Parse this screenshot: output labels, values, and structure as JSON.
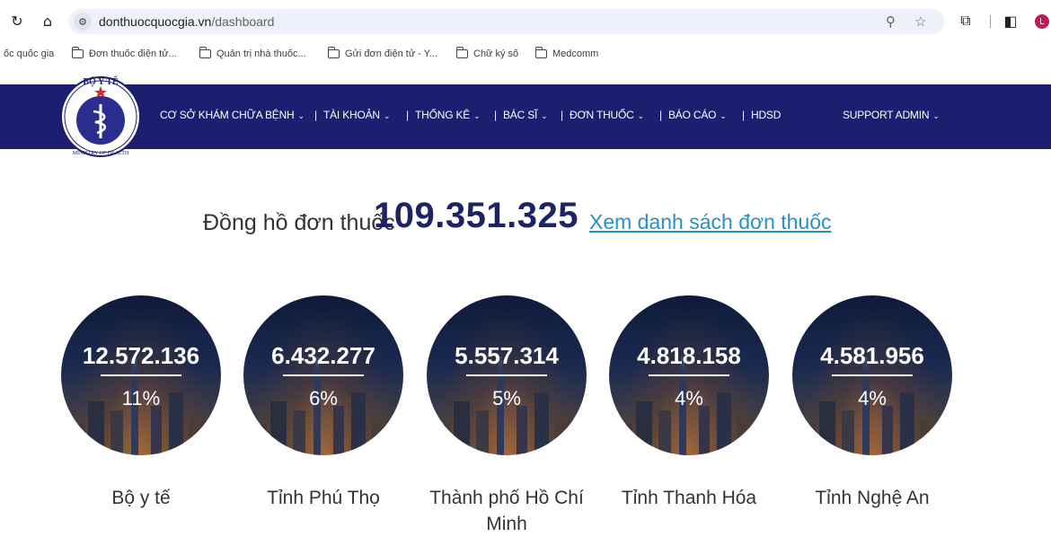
{
  "browser": {
    "url_domain": "donthuocquocgia.vn",
    "url_path": "/dashboard",
    "profile_initial": "L",
    "bookmarks": [
      "ốc quốc gia",
      "Đơn thuốc điện tử...",
      "Quản trị nhà thuốc...",
      "Gửi đơn điện tử - Y...",
      "Chữ ký số",
      "Medcomm"
    ]
  },
  "logo": {
    "top_text": "BỘ Y TẾ",
    "bottom_text": "MINISTRY OF HEALTH"
  },
  "nav": {
    "items": [
      "CƠ SỞ KHÁM CHỮA BỆNH",
      "TÀI KHOẢN",
      "THỐNG KÊ",
      "BÁC SĨ",
      "ĐƠN THUỐC",
      "BÁO CÁO",
      "HDSD"
    ],
    "user_menu": "SUPPORT ADMIN"
  },
  "counter": {
    "label": "Đồng hồ đơn thuốc",
    "value": "109.351.325",
    "link": "Xem danh sách đơn thuốc"
  },
  "stats": [
    {
      "count": "12.572.136",
      "percent": "11%",
      "name": "Bộ y tế"
    },
    {
      "count": "6.432.277",
      "percent": "6%",
      "name": "Tỉnh Phú Thọ"
    },
    {
      "count": "5.557.314",
      "percent": "5%",
      "name": "Thành phố Hồ Chí Minh"
    },
    {
      "count": "4.818.158",
      "percent": "4%",
      "name": "Tỉnh Thanh Hóa"
    },
    {
      "count": "4.581.956",
      "percent": "4%",
      "name": "Tỉnh Nghệ An"
    }
  ],
  "colors": {
    "navbar": "#1c1e6f",
    "counter_value": "#1c2466",
    "link": "#2b8fc7"
  }
}
